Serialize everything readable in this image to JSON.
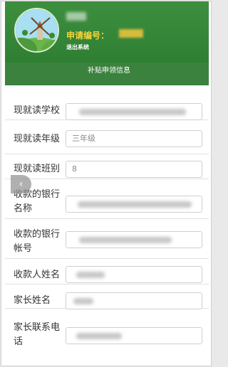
{
  "header": {
    "application_id_label": "申请编号：",
    "logout_label": "退出系统"
  },
  "section": {
    "title": "补贴申领信息"
  },
  "form": {
    "fields": [
      {
        "label": "现就读学校",
        "value": ""
      },
      {
        "label": "现就读年级",
        "value": "三年级"
      },
      {
        "label": "现就读班别",
        "value": "8"
      },
      {
        "label": "收款的银行名称",
        "value": ""
      },
      {
        "label": "收款的银行帐号",
        "value": ""
      },
      {
        "label": "收款人姓名",
        "value": ""
      },
      {
        "label": "家长姓名",
        "value": ""
      },
      {
        "label": "家长联系电话",
        "value": ""
      }
    ]
  },
  "colors": {
    "header_green": "#3d8f3e",
    "accent_yellow": "#f6d43a"
  },
  "icons": {
    "back": "chevron-left-icon",
    "avatar": "windmill-landscape-avatar"
  }
}
